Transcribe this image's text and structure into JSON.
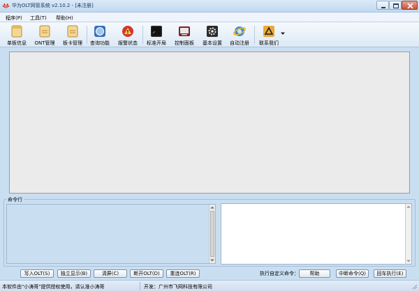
{
  "window": {
    "title": "华为OLT网管系统 v2.10.2 - [未注册]"
  },
  "menu": [
    {
      "label": "程序(P)"
    },
    {
      "label": "工具(T)"
    },
    {
      "label": "帮助(H)"
    }
  ],
  "toolbar": [
    {
      "label": "单板信息",
      "icon": "document-icon"
    },
    {
      "label": "ONT管理",
      "icon": "document-icon"
    },
    {
      "label": "板卡管理",
      "icon": "document-icon"
    },
    {
      "label": "查询功能",
      "icon": "globe-icon"
    },
    {
      "label": "报警状态",
      "icon": "warning-icon"
    },
    {
      "label": "标准开局",
      "icon": "terminal-icon"
    },
    {
      "label": "控制面板",
      "icon": "panel-icon"
    },
    {
      "label": "基本设置",
      "icon": "gear-icon"
    },
    {
      "label": "自动注册",
      "icon": "ie-icon"
    },
    {
      "label": "联系我们",
      "icon": "contact-icon"
    }
  ],
  "command": {
    "legend": "命令行",
    "custom_label": "执行自定义命令："
  },
  "buttons": {
    "write_olt": "写入OLT(S)",
    "standalone": "独立显示(B)",
    "clear": "清屏(C)",
    "disconnect": "断开OLT(D)",
    "reconnect": "重连OLT(R)",
    "help": "帮助",
    "interrupt": "中断命令(Q)",
    "enter_exec": "回车执行(E)"
  },
  "status": {
    "left": "本软件由\"小涛哥\"提供授权使用，请认准小涛哥",
    "right": "开发：广州市飞网科技有限公司"
  },
  "colors": {
    "accent": "#c9dff1",
    "close": "#c8503a"
  }
}
